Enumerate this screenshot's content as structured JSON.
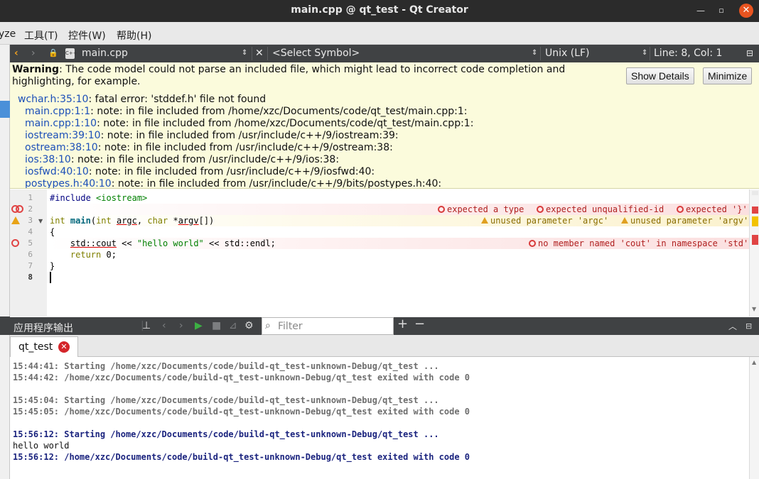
{
  "window": {
    "title": "main.cpp @ qt_test - Qt Creator"
  },
  "menu": {
    "items": [
      "yze",
      "工具(T)",
      "控件(W)",
      "帮助(H)"
    ]
  },
  "editor_toolbar": {
    "file_name": "main.cpp",
    "file_icon": "C++",
    "symbol": "<Select Symbol>",
    "line_ending": "Unix (LF)",
    "position": "Line: 8, Col: 1"
  },
  "warning": {
    "label": "Warning",
    "message": ": The code model could not parse an included file, which might lead to incorrect code completion and highlighting, for example.",
    "show_details": "Show Details",
    "minimize": "Minimize",
    "diagnostics": [
      {
        "loc": "wchar.h:35:10",
        "text": ": fatal error: 'stddef.h' file not found"
      },
      {
        "loc": "main.cpp:1:1",
        "text": ": note: in file included from /home/xzc/Documents/code/qt_test/main.cpp:1:"
      },
      {
        "loc": "main.cpp:1:10",
        "text": ": note: in file included from /home/xzc/Documents/code/qt_test/main.cpp:1:"
      },
      {
        "loc": "iostream:39:10",
        "text": ": note: in file included from /usr/include/c++/9/iostream:39:"
      },
      {
        "loc": "ostream:38:10",
        "text": ": note: in file included from /usr/include/c++/9/ostream:38:"
      },
      {
        "loc": "ios:38:10",
        "text": ": note: in file included from /usr/include/c++/9/ios:38:"
      },
      {
        "loc": "iosfwd:40:10",
        "text": ": note: in file included from /usr/include/c++/9/iosfwd:40:"
      },
      {
        "loc": "postypes.h:40:10",
        "text": ": note: in file included from /usr/include/c++/9/bits/postypes.h:40:"
      }
    ]
  },
  "code": {
    "line_numbers": [
      "1",
      "2",
      "3",
      "4",
      "5",
      "6",
      "7",
      "8"
    ],
    "line1": {
      "pp": "#include ",
      "hdr": "<iostream>"
    },
    "line3": {
      "t1": "int",
      "sp1": " ",
      "fn": "main",
      "p1": "(",
      "t2": "int",
      "sp2": " ",
      "a1": "argc",
      "c1": ", ",
      "t3": "char",
      "s1": " *",
      "a2": "argv",
      "p2": "[])"
    },
    "line4": "{",
    "line5": {
      "ind": "    ",
      "ns": "std::cout",
      "op1": " << ",
      "str": "\"hello world\"",
      "op2": " << std::endl;"
    },
    "line6": {
      "ind": "    ",
      "kw": "return",
      "rest": " 0;"
    },
    "line7": "}",
    "annotations": {
      "l2_a": "expected a type",
      "l2_b": "expected unqualified-id",
      "l2_c": "expected '}'",
      "l3_a": "unused parameter 'argc'",
      "l3_b": "unused parameter 'argv'",
      "l5_a": "no member named 'cout' in namespace 'std'"
    }
  },
  "output_pane": {
    "title": "应用程序输出",
    "filter_placeholder": "Filter",
    "tab_label": "qt_test",
    "tab_close": "✕",
    "lines": [
      "15:44:41: Starting /home/xzc/Documents/code/build-qt_test-unknown-Debug/qt_test ...",
      "15:44:42: /home/xzc/Documents/code/build-qt_test-unknown-Debug/qt_test exited with code 0",
      "15:45:04: Starting /home/xzc/Documents/code/build-qt_test-unknown-Debug/qt_test ...",
      "15:45:05: /home/xzc/Documents/code/build-qt_test-unknown-Debug/qt_test exited with code 0",
      "15:56:12: Starting /home/xzc/Documents/code/build-qt_test-unknown-Debug/qt_test ...",
      "hello world",
      "15:56:12: /home/xzc/Documents/code/build-qt_test-unknown-Debug/qt_test exited with code 0"
    ]
  },
  "icons": {
    "minimize": "minimize-icon",
    "maximize": "maximize-icon",
    "close": "close-icon",
    "back": "chevron-left-icon",
    "forward": "chevron-right-icon",
    "lock": "lock-icon",
    "error": "error-circle-icon",
    "warning": "warning-triangle-icon",
    "run": "play-icon",
    "stop": "stop-icon",
    "settings": "gear-icon",
    "search": "search-icon"
  },
  "colors": {
    "accent_close": "#e95420",
    "error": "#e04444",
    "warning": "#e8a317",
    "run": "#3cb043",
    "link": "#1c4fb8"
  }
}
